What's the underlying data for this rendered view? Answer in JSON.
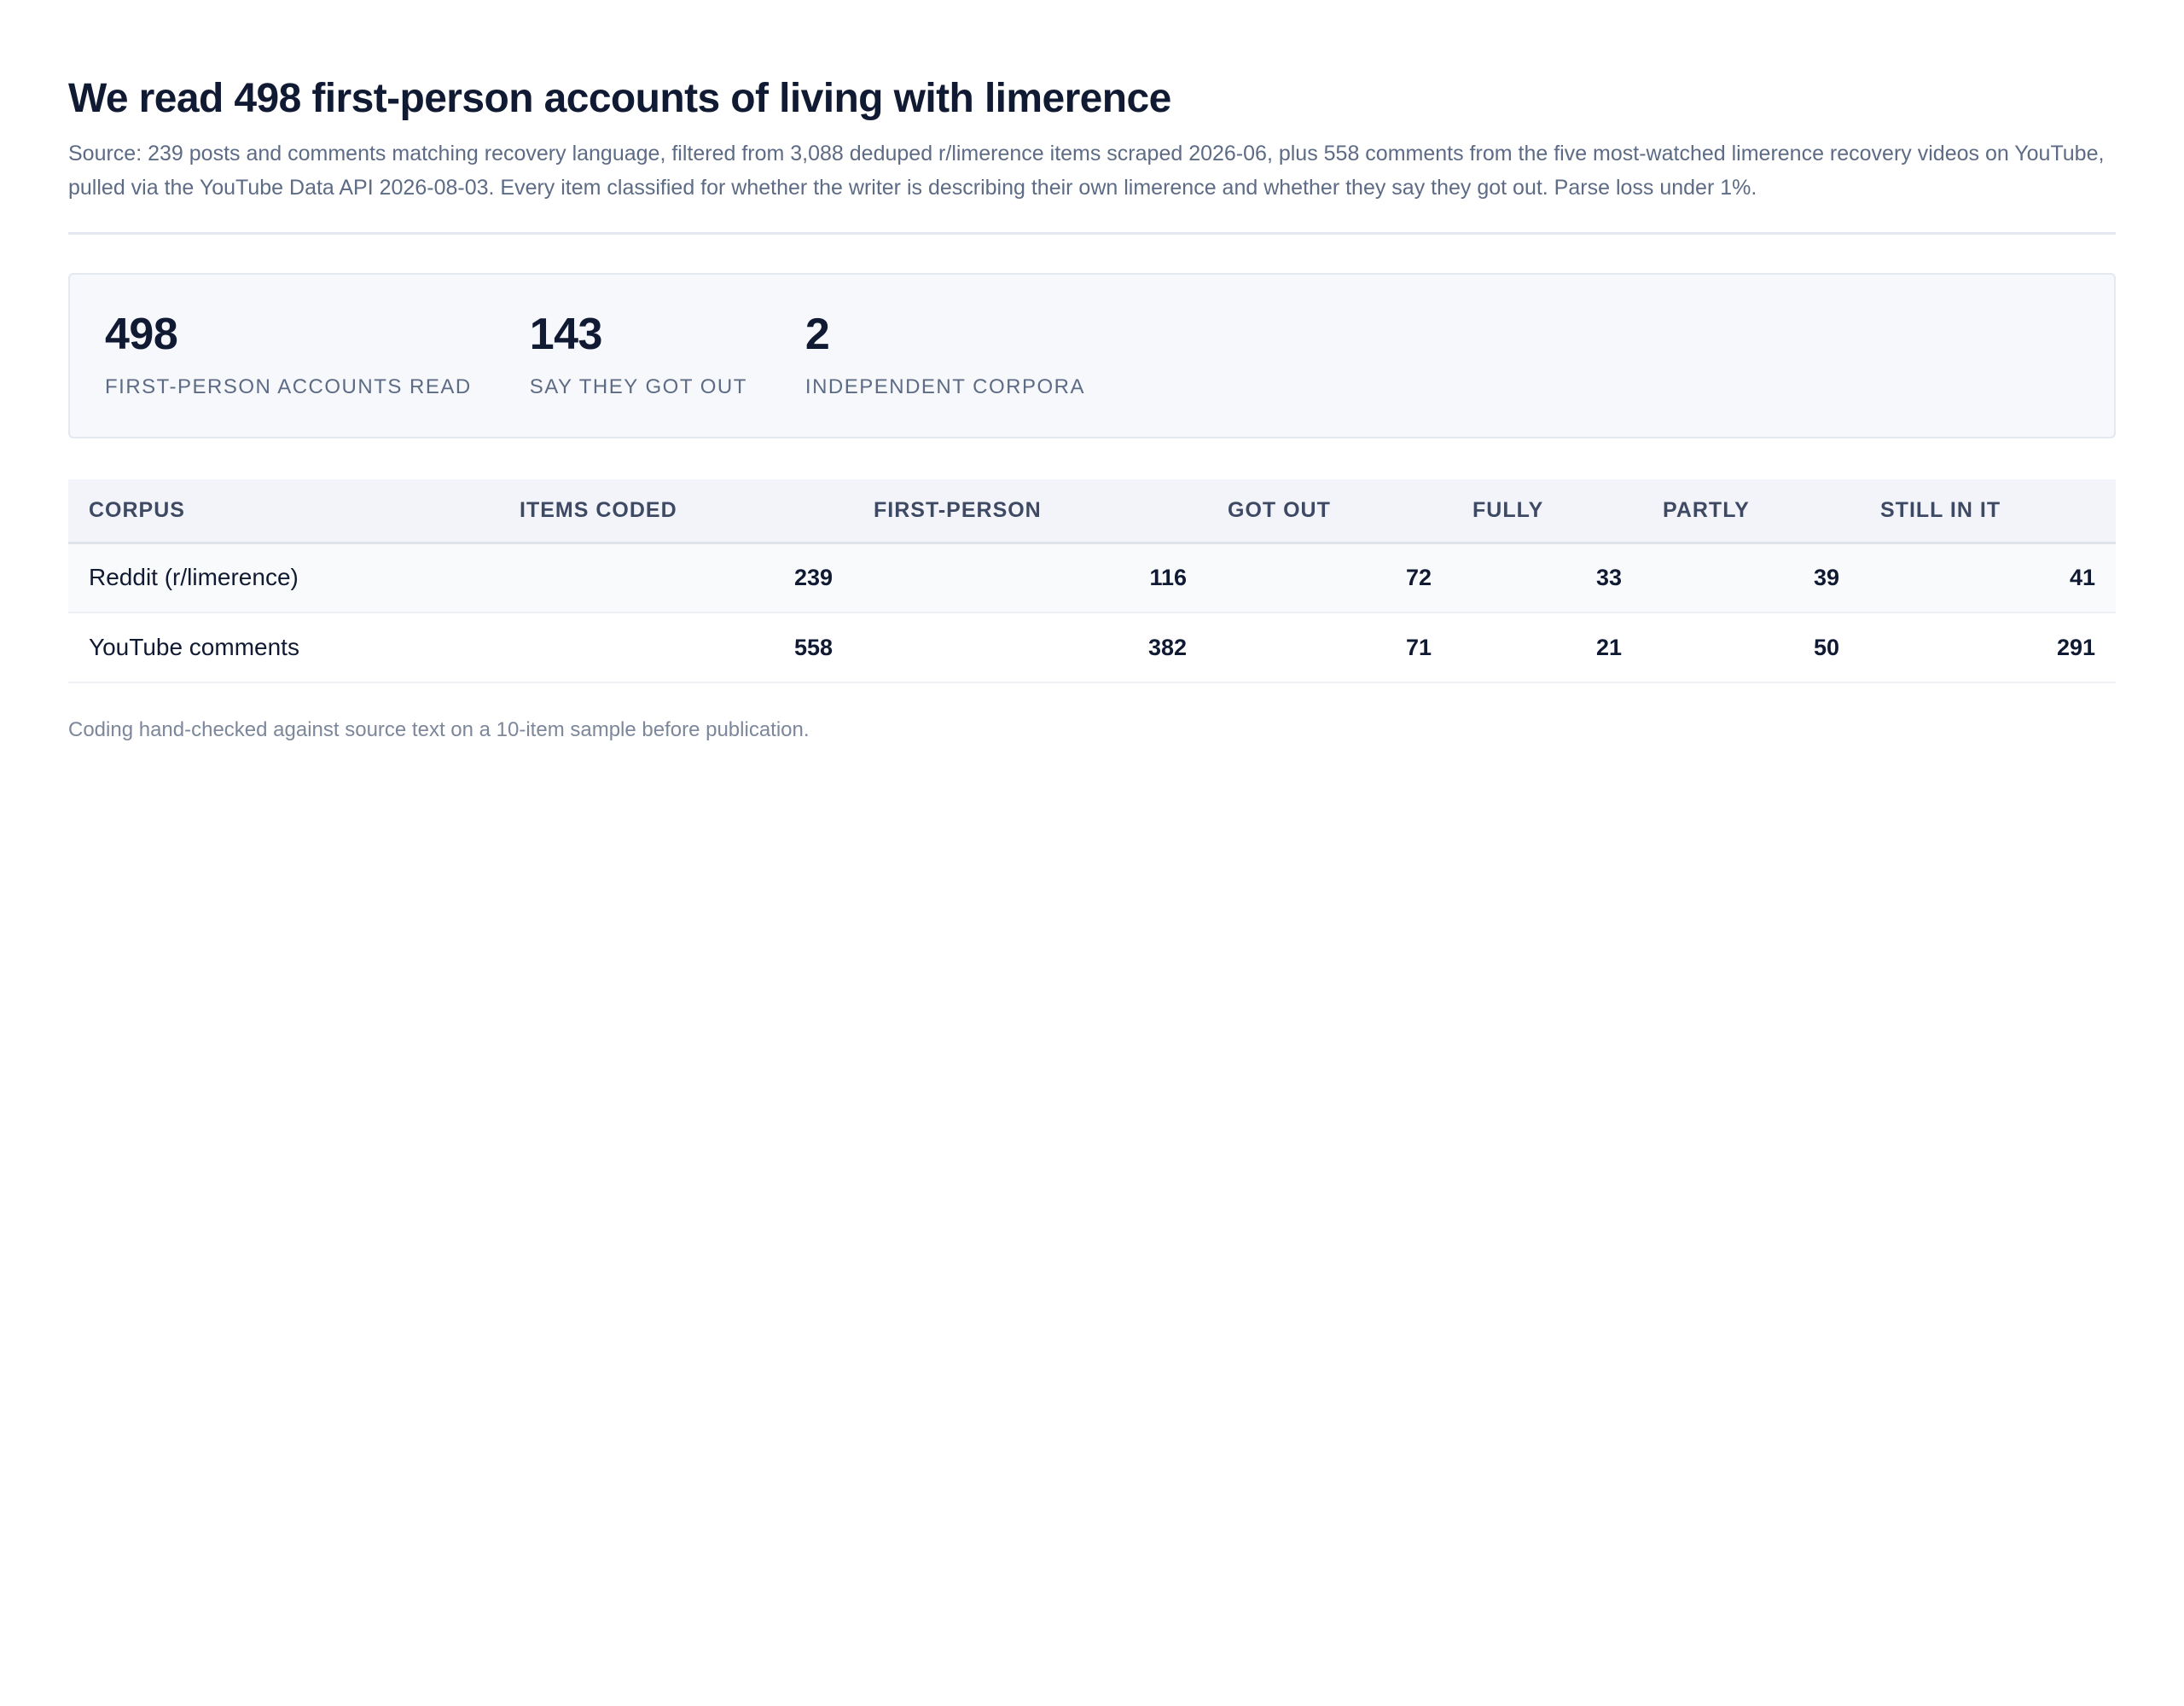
{
  "header": {
    "title": "We read 498 first-person accounts of living with limerence",
    "source": "Source: 239 posts and comments matching recovery language, filtered from 3,088 deduped r/limerence items scraped 2026-06, plus 558 comments from the five most-watched limerence recovery videos on YouTube, pulled via the YouTube Data API 2026-08-03. Every item classified for whether the writer is describing their own limerence and whether they say they got out. Parse loss under 1%."
  },
  "stats": [
    {
      "value": "498",
      "label": "First-person accounts read"
    },
    {
      "value": "143",
      "label": "Say they got out"
    },
    {
      "value": "2",
      "label": "Independent corpora"
    }
  ],
  "table": {
    "columns": [
      "Corpus",
      "Items coded",
      "First-person",
      "Got out",
      "Fully",
      "Partly",
      "Still in it"
    ],
    "rows": [
      {
        "corpus": "Reddit (r/limerence)",
        "items_coded": "239",
        "first_person": "116",
        "got_out": "72",
        "fully": "33",
        "partly": "39",
        "still_in_it": "41"
      },
      {
        "corpus": "YouTube comments",
        "items_coded": "558",
        "first_person": "382",
        "got_out": "71",
        "fully": "21",
        "partly": "50",
        "still_in_it": "291"
      }
    ]
  },
  "footnote": "Coding hand-checked against source text on a 10-item sample before publication."
}
